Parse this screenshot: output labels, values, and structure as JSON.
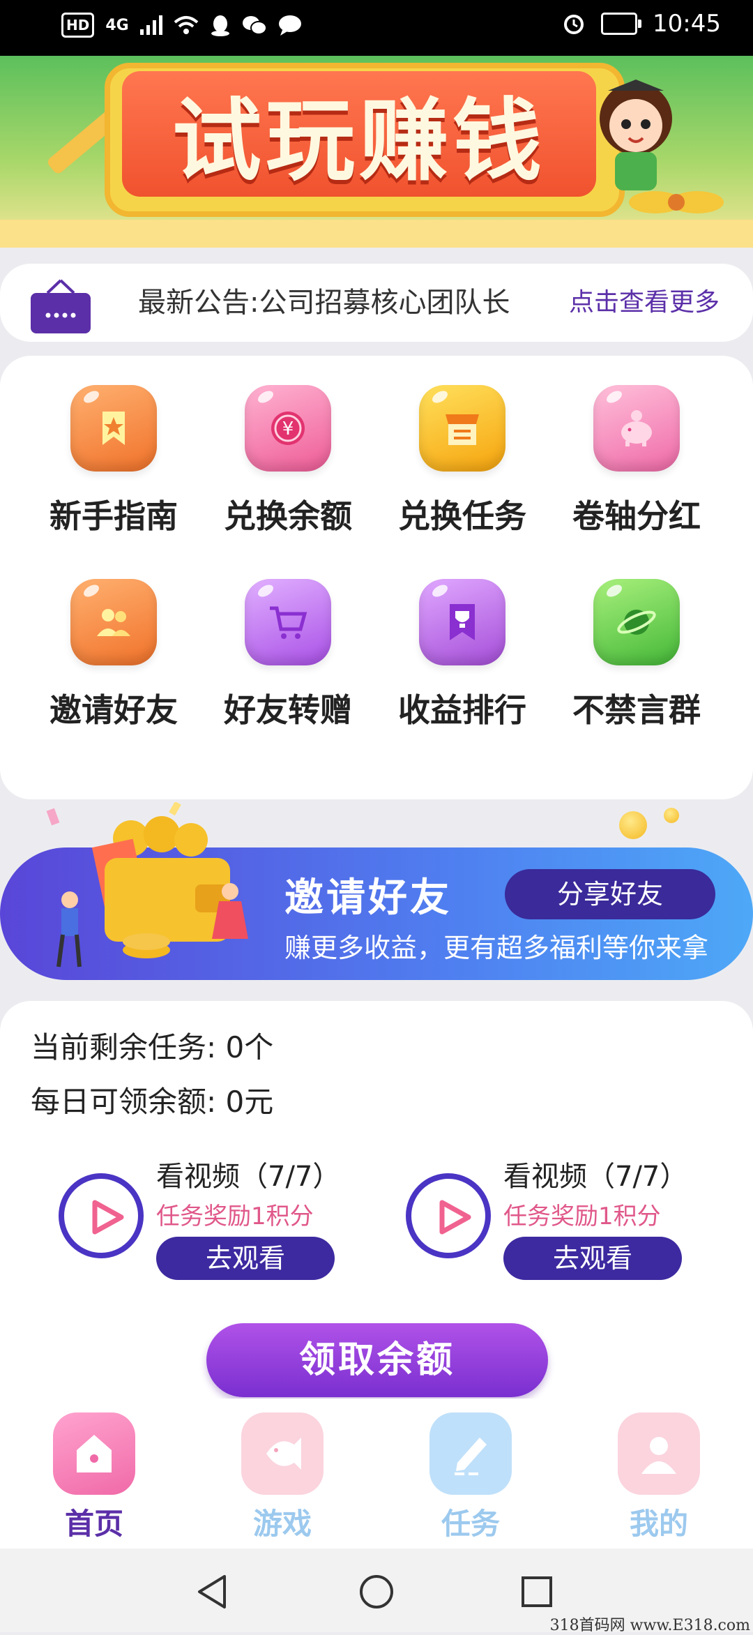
{
  "status_bar": {
    "hd": "HD",
    "network": "4G",
    "time": "10:45"
  },
  "banner": {
    "title": "试玩赚钱"
  },
  "notice": {
    "text": "最新公告:公司招募核心团队长",
    "more": "点击查看更多"
  },
  "grid": {
    "items": [
      {
        "label": "新手指南",
        "icon": "bookmark-star-icon",
        "color": "#f5853a"
      },
      {
        "label": "兑换余额",
        "icon": "yuan-coin-icon",
        "color": "#f36ba0"
      },
      {
        "label": "兑换任务",
        "icon": "shop-icon",
        "color": "#f6b41e"
      },
      {
        "label": "卷轴分红",
        "icon": "piggy-bank-icon",
        "color": "#f07cb4"
      },
      {
        "label": "邀请好友",
        "icon": "users-icon",
        "color": "#f5853a"
      },
      {
        "label": "好友转赠",
        "icon": "cart-icon",
        "color": "#b164ea"
      },
      {
        "label": "收益排行",
        "icon": "trophy-icon",
        "color": "#b45ee2"
      },
      {
        "label": "不禁言群",
        "icon": "planet-icon",
        "color": "#5dc94a"
      }
    ]
  },
  "invite": {
    "title": "邀请好友",
    "subtitle": "赚更多收益，更有超多福利等你来拿",
    "button": "分享好友"
  },
  "tasks": {
    "remaining_label": "当前剩余任务:",
    "remaining_value": "0个",
    "daily_label": "每日可领余额:",
    "daily_value": "0元",
    "videos": [
      {
        "title": "看视频（7/7）",
        "reward": "任务奖励1积分",
        "button": "去观看"
      },
      {
        "title": "看视频（7/7）",
        "reward": "任务奖励1积分",
        "button": "去观看"
      }
    ],
    "claim_button": "领取余额"
  },
  "tabs": [
    {
      "label": "首页",
      "icon": "home-icon",
      "color": "#f26aa6",
      "active": true
    },
    {
      "label": "游戏",
      "icon": "game-icon",
      "color": "#f7b0c4",
      "active": false
    },
    {
      "label": "任务",
      "icon": "task-pen-icon",
      "color": "#8cc9f3",
      "active": false
    },
    {
      "label": "我的",
      "icon": "profile-icon",
      "color": "#f7b0c4",
      "active": false
    }
  ],
  "watermark": "318首码网 www.E318.com"
}
